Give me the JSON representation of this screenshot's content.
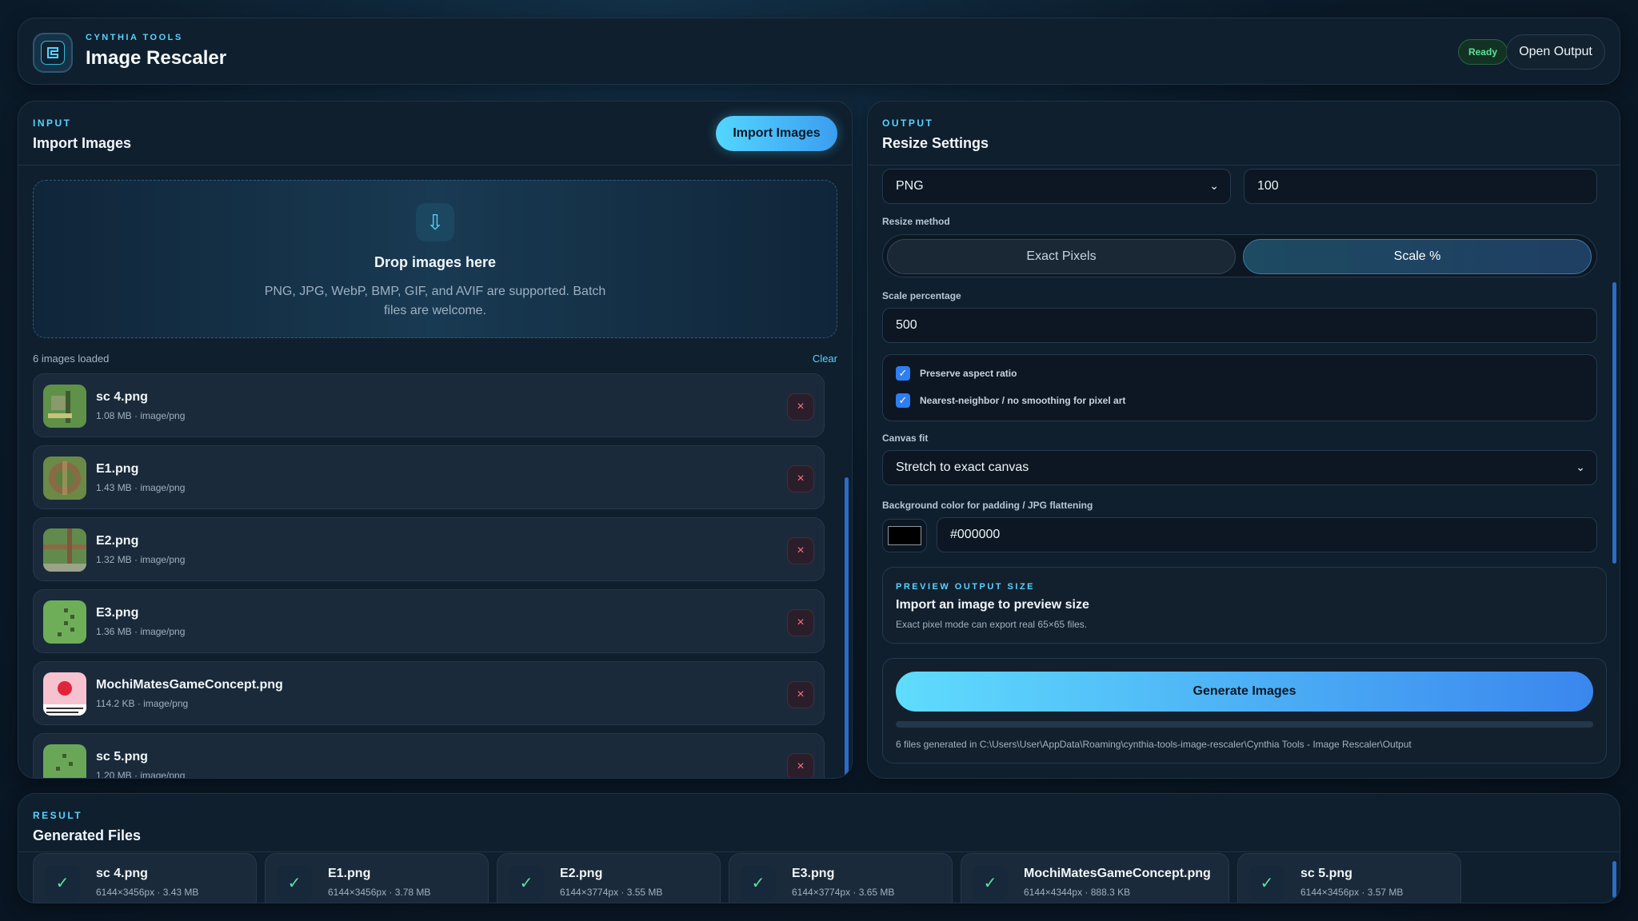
{
  "header": {
    "eyebrow": "CYNTHIA TOOLS",
    "title": "Image Rescaler",
    "status": "Ready",
    "open_output_label": "Open Output",
    "logo_icon": "app-logo-icon"
  },
  "input": {
    "eyebrow": "INPUT",
    "title": "Import Images",
    "import_button": "Import Images",
    "drop_title": "Drop images here",
    "drop_hint": "PNG, JPG, WebP, BMP, GIF, and AVIF are supported. Batch files are welcome.",
    "drop_icon": "download-arrow-icon",
    "loaded_count": "6 images loaded",
    "clear_label": "Clear",
    "remove_glyph": "×",
    "files": [
      {
        "name": "sc 4.png",
        "meta": "1.08 MB · image/png",
        "thumb": "#6a9b55"
      },
      {
        "name": "E1.png",
        "meta": "1.43 MB · image/png",
        "thumb": "#7a8f4f"
      },
      {
        "name": "E2.png",
        "meta": "1.32 MB · image/png",
        "thumb": "#6d8e55"
      },
      {
        "name": "E3.png",
        "meta": "1.36 MB · image/png",
        "thumb": "#73a95e"
      },
      {
        "name": "MochiMatesGameConcept.png",
        "meta": "114.2 KB · image/png",
        "thumb": "#f3b6c4"
      },
      {
        "name": "sc 5.png",
        "meta": "1.20 MB · image/png",
        "thumb": "#6ea05a"
      }
    ]
  },
  "output": {
    "eyebrow": "OUTPUT",
    "title": "Resize Settings",
    "format_value": "PNG",
    "quality_value": "100",
    "resize_method_label": "Resize method",
    "method_options": [
      "Exact Pixels",
      "Scale %"
    ],
    "method_selected": "Scale %",
    "scale_label": "Scale percentage",
    "scale_value": "500",
    "preserve_aspect": "Preserve aspect ratio",
    "nearest_neighbor": "Nearest-neighbor / no smoothing for pixel art",
    "canvas_fit_label": "Canvas fit",
    "canvas_fit_value": "Stretch to exact canvas",
    "bg_label": "Background color for padding / JPG flattening",
    "bg_value": "#000000",
    "preview_eyebrow": "PREVIEW OUTPUT SIZE",
    "preview_title": "Import an image to preview size",
    "preview_hint": "Exact pixel mode can export real 65×65 files.",
    "generate_label": "Generate Images",
    "progress": 0,
    "output_path": "6 files generated in C:\\Users\\User\\AppData\\Roaming\\cynthia-tools-image-rescaler\\Cynthia Tools - Image Rescaler\\Output"
  },
  "result": {
    "eyebrow": "RESULT",
    "title": "Generated Files",
    "check_glyph": "✓",
    "files": [
      {
        "name": "sc 4.png",
        "meta": "6144×3456px · 3.43 MB"
      },
      {
        "name": "E1.png",
        "meta": "6144×3456px · 3.78 MB"
      },
      {
        "name": "E2.png",
        "meta": "6144×3774px · 3.55 MB"
      },
      {
        "name": "E3.png",
        "meta": "6144×3774px · 3.65 MB"
      },
      {
        "name": "MochiMatesGameConcept.png",
        "meta": "6144×4344px · 888.3 KB"
      },
      {
        "name": "sc 5.png",
        "meta": "6144×3456px · 3.57 MB"
      }
    ]
  },
  "colors": {
    "accent": "#5ad2ff",
    "success": "#5ee29a",
    "danger": "#ff7088",
    "checkbox": "#2f7ef0"
  }
}
